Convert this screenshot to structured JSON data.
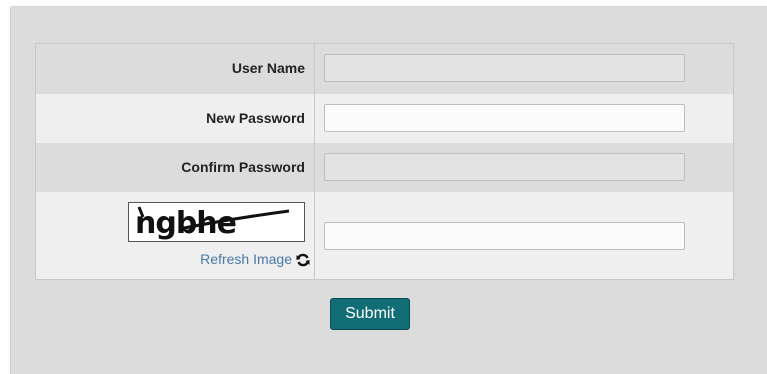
{
  "form": {
    "username_label": "User Name",
    "new_password_label": "New Password",
    "confirm_password_label": "Confirm Password",
    "username_value": "",
    "new_password_value": "",
    "confirm_password_value": "",
    "captcha_text": "ngbhe",
    "captcha_value": "",
    "refresh_label": "Refresh Image",
    "refresh_icon": "refresh-icon",
    "submit_label": "Submit"
  },
  "colors": {
    "submit_bg": "#126e76",
    "link": "#4a78a8",
    "panel_bg": "#dcdcdc"
  }
}
